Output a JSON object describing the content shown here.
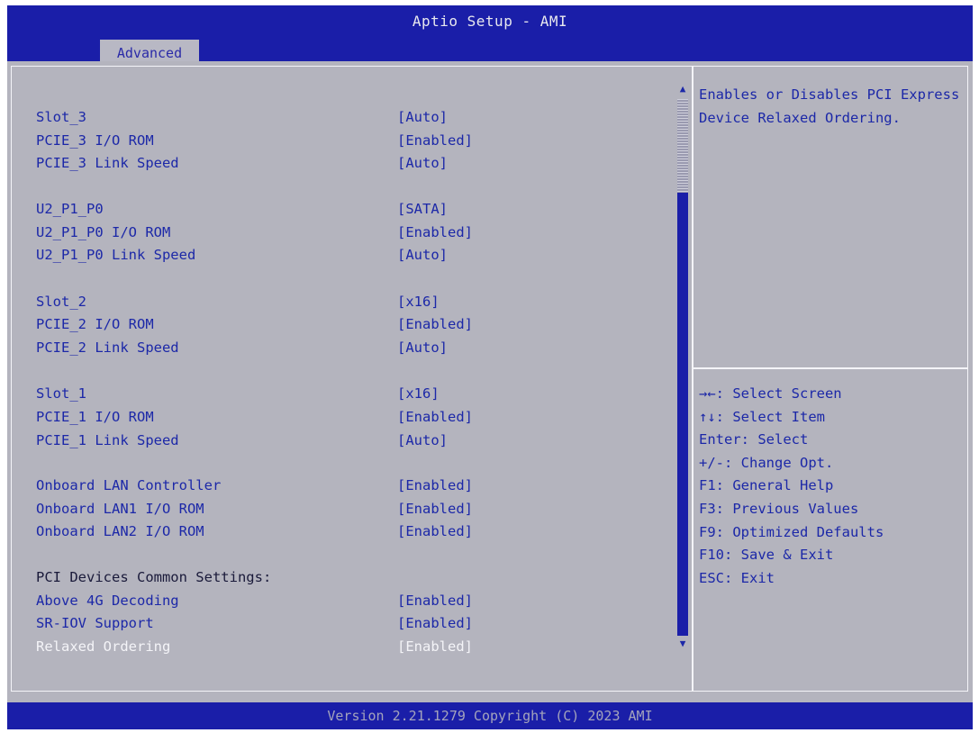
{
  "app_title": "Aptio Setup - AMI",
  "tabs": [
    {
      "label": "Advanced",
      "active": true
    }
  ],
  "settings": [
    {
      "label": "Slot_3",
      "value": "[Auto]"
    },
    {
      "label": "PCIE_3 I/O ROM",
      "value": "[Enabled]"
    },
    {
      "label": "PCIE_3 Link Speed",
      "value": "[Auto]"
    },
    {
      "label": "U2_P1_P0",
      "value": "[SATA]"
    },
    {
      "label": "U2_P1_P0 I/O ROM",
      "value": "[Enabled]"
    },
    {
      "label": "U2_P1_P0 Link Speed",
      "value": "[Auto]"
    },
    {
      "label": "Slot_2",
      "value": "[x16]"
    },
    {
      "label": "PCIE_2 I/O ROM",
      "value": "[Enabled]"
    },
    {
      "label": "PCIE_2 Link Speed",
      "value": "[Auto]"
    },
    {
      "label": "Slot_1",
      "value": "[x16]"
    },
    {
      "label": "PCIE_1 I/O ROM",
      "value": "[Enabled]"
    },
    {
      "label": "PCIE_1 Link Speed",
      "value": "[Auto]"
    },
    {
      "label": "Onboard LAN Controller",
      "value": "[Enabled]"
    },
    {
      "label": "Onboard LAN1 I/O ROM",
      "value": "[Enabled]"
    },
    {
      "label": "Onboard LAN2 I/O ROM",
      "value": "[Enabled]"
    },
    {
      "label": "PCI Devices Common Settings:",
      "value": ""
    },
    {
      "label": "Above 4G Decoding",
      "value": "[Enabled]"
    },
    {
      "label": "SR-IOV Support",
      "value": "[Enabled]"
    },
    {
      "label": "Relaxed Ordering",
      "value": "[Enabled]",
      "selected": true
    }
  ],
  "help_text": "Enables or Disables PCI Express Device Relaxed Ordering.",
  "key_legend": [
    "→←: Select Screen",
    "↑↓: Select Item",
    "Enter: Select",
    "+/-: Change Opt.",
    "F1: General Help",
    "F3: Previous Values",
    "F9: Optimized Defaults",
    "F10: Save & Exit",
    "ESC: Exit"
  ],
  "footer": "Version 2.21.1279 Copyright (C) 2023 AMI",
  "colors": {
    "header_bg": "#1a1ea8",
    "panel_bg": "#b4b4be",
    "text_blue": "#1c28a8",
    "selected_text": "#f4f4f8"
  },
  "icons": {
    "scroll_up": "scroll-up-arrow-icon",
    "scroll_down": "scroll-down-arrow-icon"
  }
}
